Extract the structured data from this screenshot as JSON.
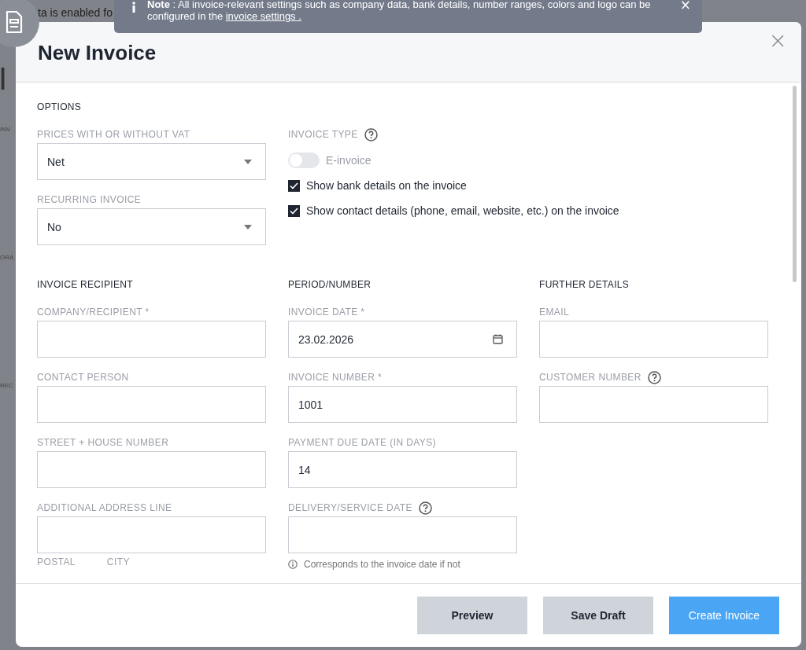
{
  "background": {
    "notice": "ta is enabled fo",
    "heading": "I",
    "sidebar_labels": [
      "INV",
      "ORA",
      "REC"
    ]
  },
  "note": {
    "text": "**Note** : All invoice-relevant settings such as company data, bank details, number ranges, colors and logo can be configured in the ",
    "link": "invoice settings .",
    "close": "×"
  },
  "modal": {
    "title": "New Invoice",
    "close": "×"
  },
  "options": {
    "heading": "OPTIONS",
    "selects": [
      {
        "label": "PRICES WITH OR WITHOUT VAT",
        "value": "Net"
      },
      {
        "label": "RECURRING INVOICE",
        "value": "No"
      }
    ],
    "invoice_type": {
      "label": "INVOICE TYPE",
      "toggle": {
        "label": "E-invoice",
        "on": false,
        "disabled": true
      }
    },
    "checkboxes": [
      {
        "label": "Show bank details on the invoice",
        "checked": true
      },
      {
        "label": "Show contact details (phone, email, website, etc.) on the invoice",
        "checked": true
      }
    ]
  },
  "columns": [
    {
      "heading": "INVOICE RECIPIENT",
      "fields": [
        {
          "label": "COMPANY/RECIPIENT *",
          "kind": "text",
          "help": false
        },
        {
          "label": "CONTACT PERSON",
          "kind": "text",
          "help": false
        },
        {
          "label": "STREET + HOUSE NUMBER",
          "kind": "text",
          "help": false
        },
        {
          "label": "ADDITIONAL ADDRESS LINE",
          "kind": "text",
          "help": false
        }
      ],
      "cut_labels": [
        "POSTAL",
        "CITY"
      ]
    },
    {
      "heading": "PERIOD/NUMBER",
      "fields": [
        {
          "label": "INVOICE DATE *",
          "kind": "date",
          "value": "23.02.2026",
          "help": false
        },
        {
          "label": "INVOICE NUMBER *",
          "kind": "text",
          "value": "1001",
          "help": false
        },
        {
          "label": "PAYMENT DUE DATE (IN DAYS)",
          "kind": "text",
          "value": "14",
          "help": false
        },
        {
          "label": "DELIVERY/SERVICE DATE",
          "kind": "text",
          "help": true
        }
      ],
      "hint": "Corresponds to the invoice date if not"
    },
    {
      "heading": "FURTHER DETAILS",
      "fields": [
        {
          "label": "EMAIL",
          "kind": "text",
          "help": false
        },
        {
          "label": "CUSTOMER NUMBER",
          "kind": "text",
          "help": true
        }
      ]
    }
  ],
  "buttons": [
    {
      "label": "Preview",
      "kind": "secondary"
    },
    {
      "label": "Save Draft",
      "kind": "secondary"
    },
    {
      "label": "Create Invoice",
      "kind": "primary"
    }
  ]
}
